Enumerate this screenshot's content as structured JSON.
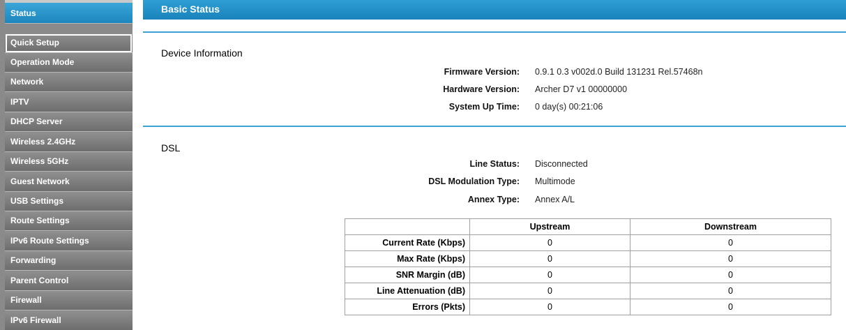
{
  "sidebar": {
    "items": [
      {
        "label": "Status"
      },
      {
        "label": "Quick Setup"
      },
      {
        "label": "Operation Mode"
      },
      {
        "label": "Network"
      },
      {
        "label": "IPTV"
      },
      {
        "label": "DHCP Server"
      },
      {
        "label": "Wireless 2.4GHz"
      },
      {
        "label": "Wireless 5GHz"
      },
      {
        "label": "Guest Network"
      },
      {
        "label": "USB Settings"
      },
      {
        "label": "Route Settings"
      },
      {
        "label": "IPv6 Route Settings"
      },
      {
        "label": "Forwarding"
      },
      {
        "label": "Parent Control"
      },
      {
        "label": "Firewall"
      },
      {
        "label": "IPv6 Firewall"
      }
    ]
  },
  "page": {
    "title": "Basic Status"
  },
  "device": {
    "section_title": "Device Information",
    "firmware_label": "Firmware Version:",
    "firmware_value": "0.9.1 0.3 v002d.0 Build 131231 Rel.57468n",
    "hardware_label": "Hardware Version:",
    "hardware_value": "Archer D7 v1 00000000",
    "uptime_label": "System Up Time:",
    "uptime_value": "0 day(s) 00:21:06"
  },
  "dsl": {
    "section_title": "DSL",
    "line_status_label": "Line Status:",
    "line_status_value": "Disconnected",
    "modulation_label": "DSL Modulation Type:",
    "modulation_value": "Multimode",
    "annex_label": "Annex Type:",
    "annex_value": "Annex A/L",
    "table": {
      "headers": [
        "",
        "Upstream",
        "Downstream"
      ],
      "rows": [
        {
          "label": "Current Rate (Kbps)",
          "upstream": "0",
          "downstream": "0"
        },
        {
          "label": "Max Rate (Kbps)",
          "upstream": "0",
          "downstream": "0"
        },
        {
          "label": "SNR Margin (dB)",
          "upstream": "0",
          "downstream": "0"
        },
        {
          "label": "Line Attenuation (dB)",
          "upstream": "0",
          "downstream": "0"
        },
        {
          "label": "Errors (Pkts)",
          "upstream": "0",
          "downstream": "0"
        }
      ]
    }
  },
  "colors": {
    "accent": "#1c86be",
    "sidebar": "#7a7a7a"
  }
}
